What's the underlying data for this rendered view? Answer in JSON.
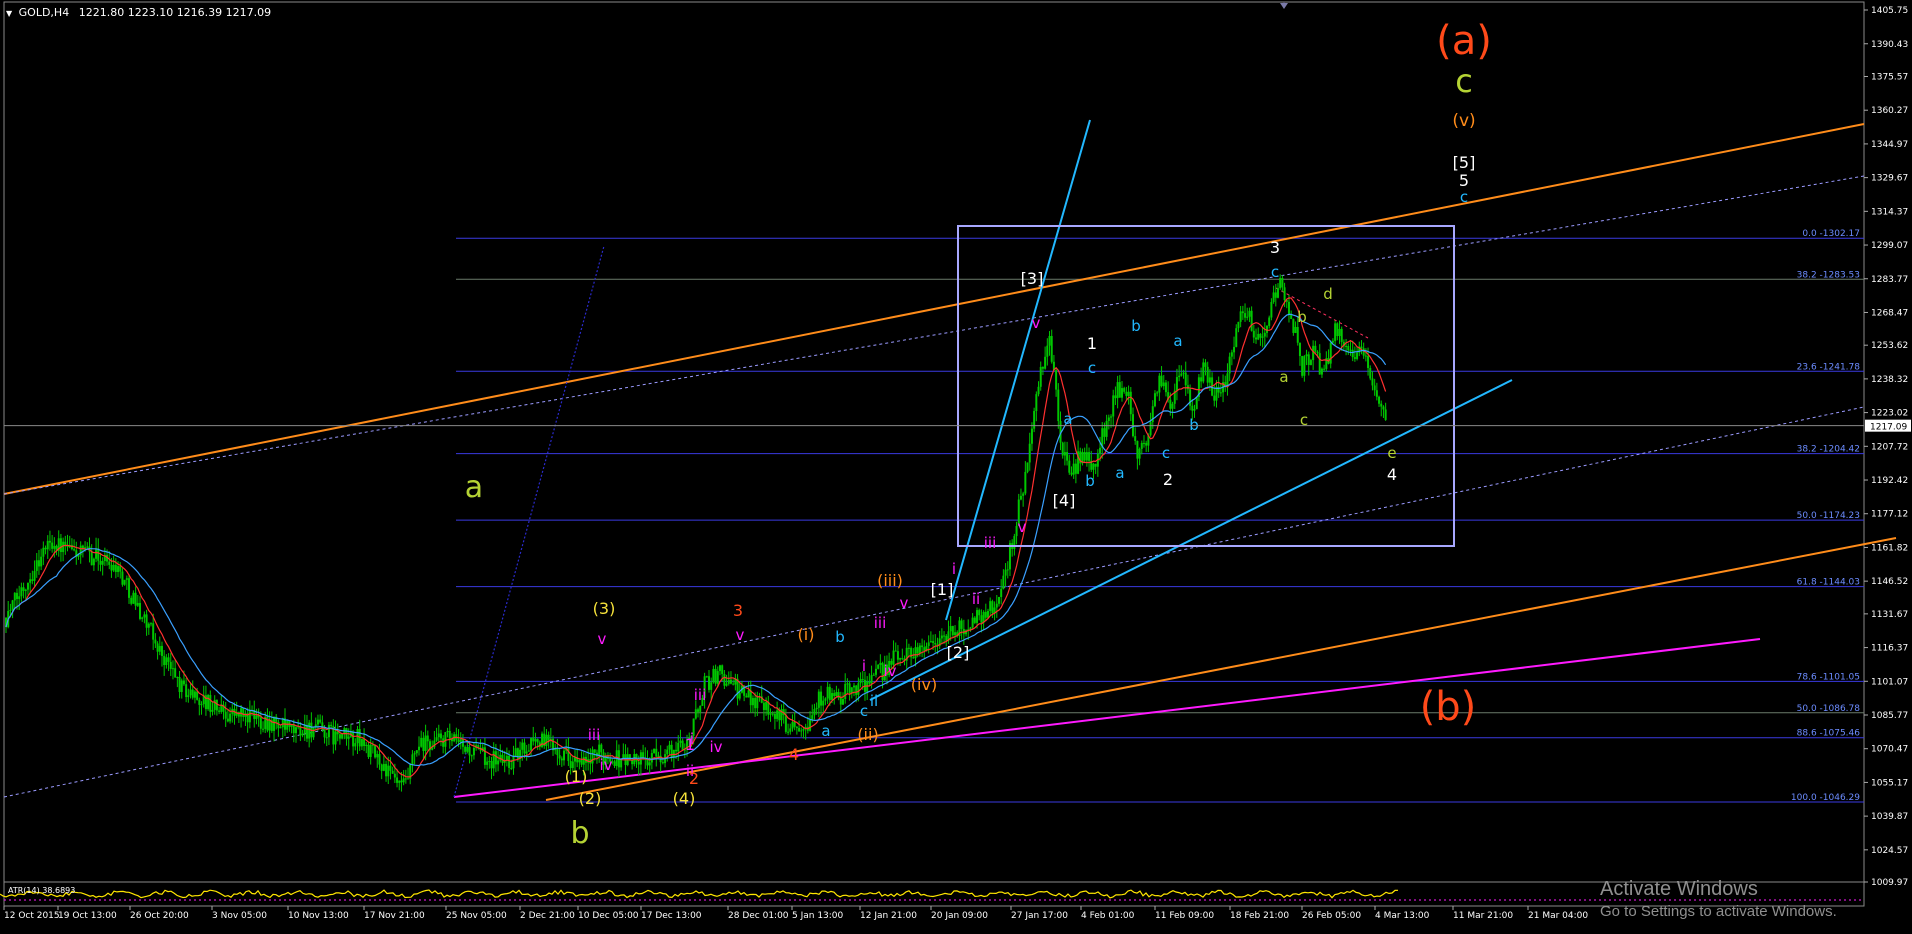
{
  "header": {
    "symbol": "GOLD,H4",
    "ohlc": "1221.80 1223.10 1216.39 1217.09"
  },
  "watermark": {
    "line1": "Activate Windows",
    "line2": "Go to Settings to activate Windows."
  },
  "colors": {
    "background": "#000000",
    "bull_candle": "#00c800",
    "ma_fast": "#ff3030",
    "ma_slow": "#3aa0ff",
    "orange_channel": "#ff8c1a",
    "magenta_line": "#ff1aff",
    "cyan_line": "#22b8ff",
    "fib_line": "#3a3ae0",
    "box": "#a8a8ff"
  },
  "chart_data": [
    {
      "type": "line",
      "title": "GOLD,H4",
      "last_price": "1217.09",
      "ylim": [
        1009.97,
        1405.75
      ],
      "y_ticks": [
        "1405.75",
        "1390.43",
        "1375.57",
        "1360.27",
        "1344.97",
        "1329.67",
        "1314.37",
        "1299.07",
        "1283.77",
        "1268.47",
        "1253.62",
        "1238.32",
        "1223.02",
        "1207.72",
        "1192.42",
        "1177.12",
        "1161.82",
        "1146.52",
        "1131.67",
        "1116.37",
        "1101.07",
        "1085.77",
        "1070.47",
        "1055.17",
        "1039.87",
        "1024.57",
        "1009.97"
      ],
      "x_ticks": [
        "12 Oct 2015",
        "19 Oct 13:00",
        "26 Oct 20:00",
        "3 Nov 05:00",
        "10 Nov 13:00",
        "17 Nov 21:00",
        "25 Nov 05:00",
        "2 Dec 21:00",
        "10 Dec 05:00",
        "17 Dec 13:00",
        "28 Dec 01:00",
        "5 Jan 13:00",
        "12 Jan 21:00",
        "20 Jan 09:00",
        "27 Jan 17:00",
        "4 Feb 01:00",
        "11 Feb 09:00",
        "18 Feb 21:00",
        "26 Feb 05:00",
        "4 Mar 13:00",
        "11 Mar 21:00",
        "21 Mar 04:00"
      ],
      "series": [
        {
          "x": [
            0,
            20,
            25,
            30,
            40,
            50,
            60,
            70,
            80,
            90,
            100,
            110,
            120,
            130,
            140,
            150,
            160,
            170,
            175,
            180,
            183,
            186,
            190,
            200,
            210,
            220,
            230,
            240,
            250,
            262,
            270,
            280,
            290,
            300,
            306,
            312,
            318,
            325,
            335,
            345,
            355,
            365,
            372,
            378,
            385,
            395,
            405,
            415,
            425,
            435,
            442,
            450,
            455,
            460,
            465,
            470,
            475,
            480,
            485,
            490,
            495,
            500,
            505,
            510,
            515,
            520,
            525,
            530,
            535,
            540,
            545,
            550,
            555,
            560,
            565,
            570
          ],
          "close": [
            1130,
            1165,
            1162,
            1160,
            1158,
            1154,
            1135,
            1115,
            1098,
            1092,
            1087,
            1085,
            1083,
            1078,
            1080,
            1076,
            1075,
            1065,
            1058,
            1052,
            1056,
            1068,
            1072,
            1075,
            1070,
            1066,
            1065,
            1075,
            1072,
            1062,
            1068,
            1066,
            1065,
            1068,
            1070,
            1078,
            1100,
            1105,
            1095,
            1092,
            1082,
            1083,
            1096,
            1092,
            1098,
            1102,
            1112,
            1116,
            1120,
            1125,
            1130,
            1135,
            1150,
            1175,
            1200,
            1235,
            1258,
            1210,
            1195,
            1205,
            1198,
            1215,
            1232,
            1235,
            1200,
            1215,
            1238,
            1228,
            1240,
            1224,
            1242,
            1232,
            1238,
            1262,
            1270,
            1255
          ]
        },
        {
          "x": [
            580,
            585,
            590,
            595,
            600,
            605,
            610,
            615,
            620,
            628
          ],
          "close": [
            1282,
            1268,
            1243,
            1250,
            1240,
            1262,
            1255,
            1250,
            1245,
            1218
          ]
        }
      ],
      "oscillator": {
        "label": "ATR(14) 38.6893"
      }
    }
  ],
  "fibonacci": [
    {
      "label": "0.0 -1302.17",
      "value": 1302.17
    },
    {
      "label": "38.2 -1283.53",
      "value": 1283.53
    },
    {
      "label": "23.6 -1241.78",
      "value": 1241.78
    },
    {
      "label": "38.2 -1204.42",
      "value": 1204.42
    },
    {
      "label": "50.0 -1174.23",
      "value": 1174.23
    },
    {
      "label": "61.8 -1144.03",
      "value": 1144.03
    },
    {
      "label": "78.6 -1101.05",
      "value": 1101.05
    },
    {
      "label": "50.0 -1086.78",
      "value": 1086.78
    },
    {
      "label": "88.6 -1075.46",
      "value": 1075.46
    },
    {
      "label": "100.0 -1046.29",
      "value": 1046.29
    }
  ],
  "wave_labels": [
    {
      "text": "(a)",
      "color": "#ff4a1a",
      "size": 40
    },
    {
      "text": "c",
      "color": "#b5d334",
      "size": 32
    },
    {
      "text": "(v)",
      "color": "#ff8c1a",
      "size": 17
    },
    {
      "text": "[5]",
      "color": "#ffffff",
      "size": 16
    },
    {
      "text": "5",
      "color": "#ffffff",
      "size": 16
    },
    {
      "text": "c",
      "color": "#22b8ff",
      "size": 15
    },
    {
      "text": "(b)",
      "color": "#ff4a1a",
      "size": 40
    },
    {
      "text": "a",
      "color": "#b5d334",
      "size": 30
    },
    {
      "text": "b",
      "color": "#b5d334",
      "size": 30
    },
    {
      "text": "(3)",
      "color": "#f5e13a",
      "size": 16
    },
    {
      "text": "(1)",
      "color": "#f5e13a",
      "size": 16
    },
    {
      "text": "(2)",
      "color": "#f5e13a",
      "size": 16
    },
    {
      "text": "(4)",
      "color": "#f5e13a",
      "size": 16
    },
    {
      "text": "v",
      "color": "#ff1aff",
      "size": 15
    },
    {
      "text": "iii",
      "color": "#ff1aff",
      "size": 15
    },
    {
      "text": "iv",
      "color": "#ff1aff",
      "size": 15
    },
    {
      "text": "i",
      "color": "#ff1aff",
      "size": 15
    },
    {
      "text": "ii",
      "color": "#ff1aff",
      "size": 15
    },
    {
      "text": "3",
      "color": "#ff4a1a",
      "size": 16
    },
    {
      "text": "v",
      "color": "#ff1aff",
      "size": 15
    },
    {
      "text": "1",
      "color": "#ff1aff",
      "size": 16
    },
    {
      "text": "2",
      "color": "#ff4a1a",
      "size": 16
    },
    {
      "text": "iii",
      "color": "#ff1aff",
      "size": 15
    },
    {
      "text": "iv",
      "color": "#ff1aff",
      "size": 15
    },
    {
      "text": "4",
      "color": "#ff4a1a",
      "size": 16
    },
    {
      "text": "(i)",
      "color": "#ff8c1a",
      "size": 16
    },
    {
      "text": "(ii)",
      "color": "#ff8c1a",
      "size": 16
    },
    {
      "text": "(iii)",
      "color": "#ff8c1a",
      "size": 16
    },
    {
      "text": "(iv)",
      "color": "#ff8c1a",
      "size": 16
    },
    {
      "text": "a",
      "color": "#22b8ff",
      "size": 15
    },
    {
      "text": "b",
      "color": "#22b8ff",
      "size": 15
    },
    {
      "text": "c",
      "color": "#22b8ff",
      "size": 15
    },
    {
      "text": "ii",
      "color": "#22b8ff",
      "size": 15
    },
    {
      "text": "i",
      "color": "#ff1aff",
      "size": 15
    },
    {
      "text": "iv",
      "color": "#ff1aff",
      "size": 15
    },
    {
      "text": "iii",
      "color": "#ff1aff",
      "size": 15
    },
    {
      "text": "v",
      "color": "#ff1aff",
      "size": 15
    },
    {
      "text": "[1]",
      "color": "#ffffff",
      "size": 16
    },
    {
      "text": "[2]",
      "color": "#ffffff",
      "size": 16
    },
    {
      "text": "i",
      "color": "#ff1aff",
      "size": 15
    },
    {
      "text": "ii",
      "color": "#ff1aff",
      "size": 15
    },
    {
      "text": "iii",
      "color": "#ff1aff",
      "size": 15
    },
    {
      "text": "v",
      "color": "#ff1aff",
      "size": 15
    },
    {
      "text": "v",
      "color": "#ff1aff",
      "size": 15
    },
    {
      "text": "[3]",
      "color": "#ffffff",
      "size": 16
    },
    {
      "text": "[4]",
      "color": "#ffffff",
      "size": 16
    },
    {
      "text": "1",
      "color": "#ffffff",
      "size": 16
    },
    {
      "text": "c",
      "color": "#22b8ff",
      "size": 15
    },
    {
      "text": "a",
      "color": "#22b8ff",
      "size": 15
    },
    {
      "text": "b",
      "color": "#22b8ff",
      "size": 15
    },
    {
      "text": "b",
      "color": "#22b8ff",
      "size": 15
    },
    {
      "text": "a",
      "color": "#22b8ff",
      "size": 15
    },
    {
      "text": "c",
      "color": "#22b8ff",
      "size": 15
    },
    {
      "text": "2",
      "color": "#ffffff",
      "size": 16
    },
    {
      "text": "a",
      "color": "#22b8ff",
      "size": 15
    },
    {
      "text": "b",
      "color": "#22b8ff",
      "size": 15
    },
    {
      "text": "3",
      "color": "#ffffff",
      "size": 16
    },
    {
      "text": "c",
      "color": "#22b8ff",
      "size": 15
    },
    {
      "text": "d",
      "color": "#b5d334",
      "size": 15
    },
    {
      "text": "b",
      "color": "#b5d334",
      "size": 15
    },
    {
      "text": "a",
      "color": "#b5d334",
      "size": 15
    },
    {
      "text": "c",
      "color": "#b5d334",
      "size": 15
    },
    {
      "text": "e",
      "color": "#b5d334",
      "size": 15
    },
    {
      "text": "4",
      "color": "#ffffff",
      "size": 16
    }
  ]
}
